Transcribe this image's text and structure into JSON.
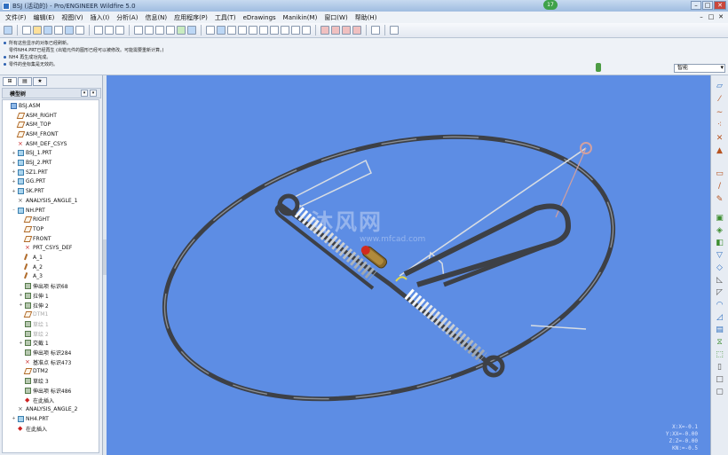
{
  "window": {
    "title": "BSJ (活动的) - Pro/ENGINEER Wildfire 5.0",
    "badge": "17",
    "minimize": "–",
    "maximize": "□",
    "close": "✕"
  },
  "menubar": {
    "items": [
      "文件(F)",
      "编辑(E)",
      "视图(V)",
      "插入(I)",
      "分析(A)",
      "信息(N)",
      "应用程序(P)",
      "工具(T)",
      "eDrawings",
      "Manikin(M)",
      "窗口(W)",
      "帮助(H)"
    ],
    "doc_controls": [
      "–",
      "□",
      "✕"
    ]
  },
  "messages": [
    "所有这些显示的对象已经刷新。",
    "零件NH4.PRT已经再生 (出错元件的图形已经可以被修改。可能需要重新计算。)",
    "NH4 再生成功完成。",
    "零件的坐标集是无效的。"
  ],
  "filter": {
    "value": "智能"
  },
  "nav": {
    "tabs": [
      "模型树",
      "文件夹",
      "收藏夹"
    ],
    "tree_title": "模型树",
    "tree_tools": [
      "▾",
      "▾"
    ],
    "items": [
      {
        "label": "BSJ.ASM",
        "icon": "asm",
        "indent": 0,
        "exp": ""
      },
      {
        "label": "ASM_RIGHT",
        "icon": "plane",
        "indent": 1,
        "exp": ""
      },
      {
        "label": "ASM_TOP",
        "icon": "plane",
        "indent": 1,
        "exp": ""
      },
      {
        "label": "ASM_FRONT",
        "icon": "plane",
        "indent": 1,
        "exp": ""
      },
      {
        "label": "ASM_DEF_CSYS",
        "icon": "csys",
        "indent": 1,
        "exp": ""
      },
      {
        "label": "BSJ_1.PRT",
        "icon": "prt",
        "indent": 1,
        "exp": "+"
      },
      {
        "label": "BSJ_2.PRT",
        "icon": "prt",
        "indent": 1,
        "exp": "+"
      },
      {
        "label": "SZ1.PRT",
        "icon": "prt",
        "indent": 1,
        "exp": "+"
      },
      {
        "label": "GG.PRT",
        "icon": "prt",
        "indent": 1,
        "exp": "+"
      },
      {
        "label": "SK.PRT",
        "icon": "prt",
        "indent": 1,
        "exp": "+"
      },
      {
        "label": "ANALYSIS_ANGLE_1",
        "icon": "ana",
        "indent": 1,
        "exp": ""
      },
      {
        "label": "NH.PRT",
        "icon": "prt",
        "indent": 1,
        "exp": "–"
      },
      {
        "label": "RIGHT",
        "icon": "plane",
        "indent": 2,
        "exp": ""
      },
      {
        "label": "TOP",
        "icon": "plane",
        "indent": 2,
        "exp": ""
      },
      {
        "label": "FRONT",
        "icon": "plane",
        "indent": 2,
        "exp": ""
      },
      {
        "label": "PRT_CSYS_DEF",
        "icon": "csys",
        "indent": 2,
        "exp": ""
      },
      {
        "label": "A_1",
        "icon": "axis",
        "indent": 2,
        "exp": ""
      },
      {
        "label": "A_2",
        "icon": "axis",
        "indent": 2,
        "exp": ""
      },
      {
        "label": "A_3",
        "icon": "axis",
        "indent": 2,
        "exp": ""
      },
      {
        "label": "伸出项 标识68",
        "icon": "feat",
        "indent": 2,
        "exp": ""
      },
      {
        "label": "拉伸 1",
        "icon": "feat",
        "indent": 2,
        "exp": "+"
      },
      {
        "label": "拉伸 2",
        "icon": "feat",
        "indent": 2,
        "exp": "+"
      },
      {
        "label": "DTM1",
        "icon": "plane",
        "indent": 2,
        "exp": "",
        "dim": true
      },
      {
        "label": "草绘 1",
        "icon": "feat",
        "indent": 2,
        "exp": "",
        "dim": true
      },
      {
        "label": "草绘 2",
        "icon": "feat",
        "indent": 2,
        "exp": "",
        "dim": true
      },
      {
        "label": "交截 1",
        "icon": "feat",
        "indent": 2,
        "exp": "+"
      },
      {
        "label": "伸出项 标识284",
        "icon": "feat",
        "indent": 2,
        "exp": ""
      },
      {
        "label": "基准点 标识473",
        "icon": "csys",
        "indent": 2,
        "exp": ""
      },
      {
        "label": "DTM2",
        "icon": "plane",
        "indent": 2,
        "exp": ""
      },
      {
        "label": "草绘 3",
        "icon": "feat",
        "indent": 2,
        "exp": ""
      },
      {
        "label": "伸出项 标识486",
        "icon": "feat",
        "indent": 2,
        "exp": ""
      },
      {
        "label": "在此插入",
        "icon": "insert",
        "indent": 2,
        "exp": ""
      },
      {
        "label": "ANALYSIS_ANGLE_2",
        "icon": "ana",
        "indent": 1,
        "exp": ""
      },
      {
        "label": "NH4.PRT",
        "icon": "prt",
        "indent": 1,
        "exp": "+"
      },
      {
        "label": "在此插入",
        "icon": "insert",
        "indent": 1,
        "exp": ""
      }
    ]
  },
  "viewport": {
    "watermark": "沐风网",
    "watermark_url": "www.mfcad.com",
    "coords": [
      "X:X=-0.1",
      "Y:XX=-0.00",
      "Z:Z=-0.00",
      "KN:=-0.5"
    ]
  },
  "toolbar_icons": [
    "help-icon",
    "new-icon",
    "open-icon",
    "save-icon",
    "print-icon",
    "email-icon",
    "undo-icon",
    "redo-icon",
    "copy-icon",
    "paste-icon",
    "regenerate-icon",
    "window-icon",
    "close-window-icon",
    "refit-icon",
    "zoom-in-icon",
    "zoom-out-icon",
    "orient-icon",
    "shading-icon",
    "datum-plane-icon",
    "datum-axis-icon",
    "datum-point-icon",
    "csys-icon"
  ],
  "right_toolbar_icons": [
    "datum-plane-icon",
    "datum-axis-icon",
    "sketch-icon",
    "datum-point-icon",
    "csys-icon",
    "analysis-icon",
    "extrude-icon",
    "revolve-icon",
    "sweep-icon",
    "blend-icon",
    "hole-icon",
    "round-icon",
    "chamfer-icon",
    "draft-icon",
    "shell-icon",
    "rib-icon",
    "mirror-icon",
    "pattern-icon",
    "merge-icon",
    "trim-icon",
    "offset-icon",
    "thicken-icon",
    "solidify-icon",
    "style-icon"
  ]
}
